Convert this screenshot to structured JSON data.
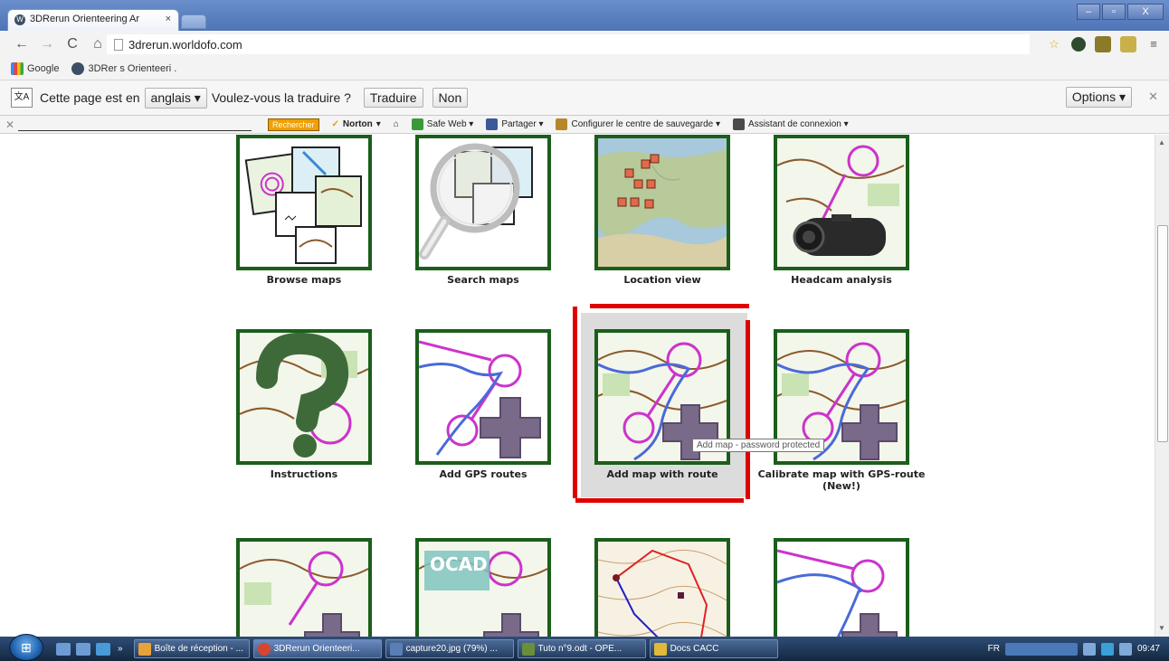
{
  "browser": {
    "tab_title": "3DRerun Orienteering Ar",
    "tab_close": "×",
    "url": "3drerun.worldofo.com"
  },
  "bookmarks": [
    {
      "label": "Google"
    },
    {
      "label": "3DRer   s Orienteeri  ."
    }
  ],
  "translate_bar": {
    "prefix": "Cette page est en",
    "language": "anglais ▾",
    "question": "Voulez-vous la traduire ?",
    "translate_button": "Traduire",
    "no_button": "Non",
    "options_button": "Options ▾"
  },
  "norton_bar": {
    "search_button": "Rechercher",
    "norton_label": "Norton",
    "items": [
      {
        "label": "Safe Web ▾",
        "color": "#3a9a3a"
      },
      {
        "label": "Partager ▾",
        "color": "#3b5998"
      },
      {
        "label": "Configurer le centre de sauvegarde ▾",
        "color": "#b8862a"
      },
      {
        "label": "Assistant de connexion ▾",
        "color": "#4a4a4a"
      }
    ]
  },
  "tiles": [
    {
      "label": "Browse maps"
    },
    {
      "label": "Search maps"
    },
    {
      "label": "Location view"
    },
    {
      "label": "Headcam analysis"
    },
    {
      "label": "Instructions"
    },
    {
      "label": "Add GPS routes"
    },
    {
      "label": "Add map with route"
    },
    {
      "label": "Calibrate map with GPS-route (New!)"
    },
    {
      "label": ""
    },
    {
      "label": ""
    },
    {
      "label": ""
    },
    {
      "label": ""
    }
  ],
  "tooltip": "Add map - password protected",
  "taskbar": {
    "tasks": [
      {
        "label": "Boîte de réception - ...",
        "color": "#e8a23a"
      },
      {
        "label": "3DRerun Orienteeri...",
        "color": "#d8452e"
      },
      {
        "label": "capture20.jpg (79%) ...",
        "color": "#5a7fb8"
      },
      {
        "label": "Tuto n°9.odt - OPE...",
        "color": "#6b8e3a"
      },
      {
        "label": "Docs CACC",
        "color": "#e0b83a"
      }
    ],
    "language": "FR",
    "clock": "09:47"
  },
  "colors": {
    "tile_border": "#1b5e1b",
    "highlight_red": "#e00000",
    "selected_bg": "#dcdcdc"
  }
}
